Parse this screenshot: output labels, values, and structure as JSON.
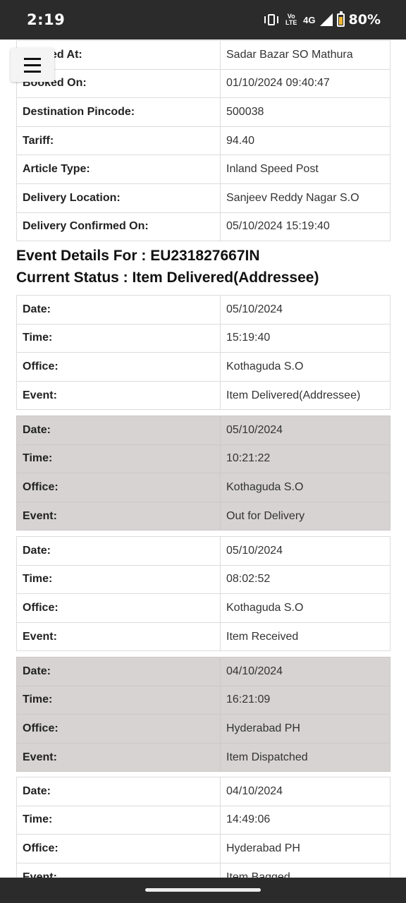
{
  "status_bar": {
    "time": "2:19",
    "network": "4G",
    "volte": "Vo LTE",
    "battery": "80%"
  },
  "menu": {
    "icon": "hamburger-menu-icon"
  },
  "booking": [
    {
      "label": "Booked At:",
      "value": "Sadar Bazar SO Mathura"
    },
    {
      "label": "Booked On:",
      "value": "01/10/2024 09:40:47"
    },
    {
      "label": "Destination Pincode:",
      "value": "500038"
    },
    {
      "label": "Tariff:",
      "value": "94.40"
    },
    {
      "label": "Article Type:",
      "value": "Inland Speed Post"
    },
    {
      "label": "Delivery Location:",
      "value": "Sanjeev Reddy Nagar S.O"
    },
    {
      "label": "Delivery Confirmed On:",
      "value": "05/10/2024 15:19:40"
    }
  ],
  "event_heading": "Event Details For : EU231827667IN",
  "status_heading": "Current Status : Item Delivered(Addressee)",
  "labels": {
    "date": "Date:",
    "time": "Time:",
    "office": "Office:",
    "event": "Event:"
  },
  "events": [
    {
      "date": "05/10/2024",
      "time": "15:19:40",
      "office": "Kothaguda S.O",
      "event": "Item Delivered(Addressee)"
    },
    {
      "date": "05/10/2024",
      "time": "10:21:22",
      "office": "Kothaguda S.O",
      "event": "Out for Delivery"
    },
    {
      "date": "05/10/2024",
      "time": "08:02:52",
      "office": "Kothaguda S.O",
      "event": "Item Received"
    },
    {
      "date": "04/10/2024",
      "time": "16:21:09",
      "office": "Hyderabad PH",
      "event": "Item Dispatched"
    },
    {
      "date": "04/10/2024",
      "time": "14:49:06",
      "office": "Hyderabad PH",
      "event": "Item Bagged"
    }
  ],
  "colors": {
    "status_bar": "#2b2b2b",
    "alt_row": "#d6d3d2",
    "border": "#dcdcdc"
  }
}
